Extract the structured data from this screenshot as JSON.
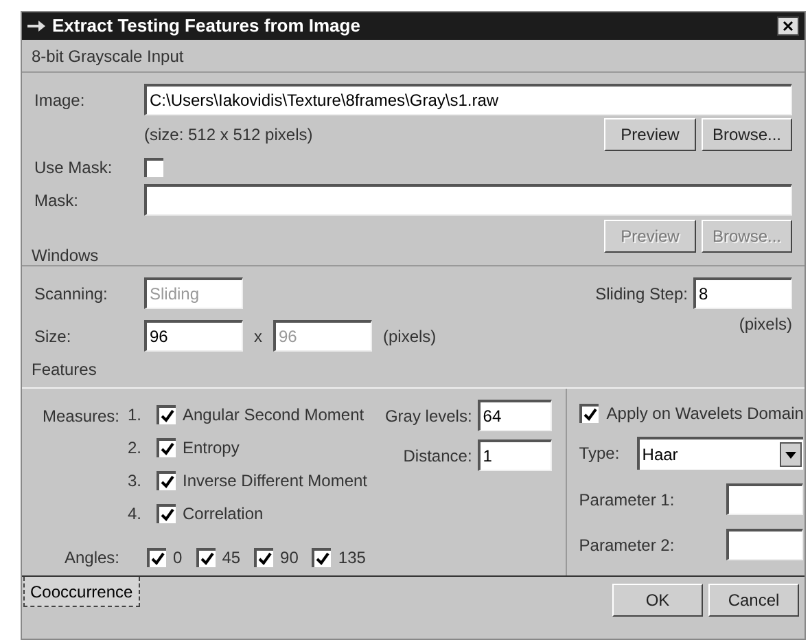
{
  "window": {
    "title": "Extract Testing Features from Image"
  },
  "input_section": {
    "title": "8-bit Grayscale Input",
    "image": {
      "label": "Image:",
      "value": "C:\\Users\\Iakovidis\\Texture\\8frames\\Gray\\s1.raw"
    },
    "size_note": "(size: 512 x 512 pixels)",
    "image_buttons": [
      {
        "label": "Preview",
        "disabled": false
      },
      {
        "label": "Browse...",
        "disabled": false
      }
    ],
    "use_mask": {
      "label": "Use Mask:",
      "checked": false
    },
    "mask": {
      "label": "Mask:"
    },
    "mask_buttons": [
      {
        "label": "Preview",
        "disabled": true
      },
      {
        "label": "Browse...",
        "disabled": true
      }
    ]
  },
  "windows_section": {
    "title": "Windows",
    "scanning": {
      "label": "Scanning:",
      "value": "Sliding",
      "disabled": true
    },
    "size": {
      "label": "Size:",
      "width": {
        "value": "96",
        "disabled": false
      },
      "separator": "x",
      "height": {
        "value": "96",
        "disabled": true
      },
      "unit": "(pixels)"
    },
    "sliding_step": {
      "label": "Sliding Step:",
      "value": "8",
      "unit": "(pixels)"
    }
  },
  "features_section": {
    "title": "Features",
    "measures_label": "Measures:",
    "measures": [
      {
        "number": "1.",
        "label": "Angular Second Moment",
        "checked": true
      },
      {
        "number": "2.",
        "label": "Entropy",
        "checked": true
      },
      {
        "number": "3.",
        "label": "Inverse Different Moment",
        "checked": true
      },
      {
        "number": "4.",
        "label": "Correlation",
        "checked": true
      }
    ],
    "gray_levels": {
      "label": "Gray levels:",
      "value": "64"
    },
    "distance": {
      "label": "Distance:",
      "value": "1"
    },
    "angles_label": "Angles:",
    "angles": [
      {
        "label": "0",
        "checked": true
      },
      {
        "label": "45",
        "checked": true
      },
      {
        "label": "90",
        "checked": true
      },
      {
        "label": "135",
        "checked": true
      }
    ],
    "wavelets": {
      "label": "Apply on Wavelets Domain",
      "checked": true
    },
    "type": {
      "label": "Type:",
      "value": "Haar"
    },
    "parameters": [
      {
        "label": "Parameter 1:"
      },
      {
        "label": "Parameter 2:"
      }
    ]
  },
  "tabs": [
    {
      "label": "Cooccurrence",
      "selected": true
    }
  ],
  "buttons": [
    "OK",
    "Cancel"
  ]
}
